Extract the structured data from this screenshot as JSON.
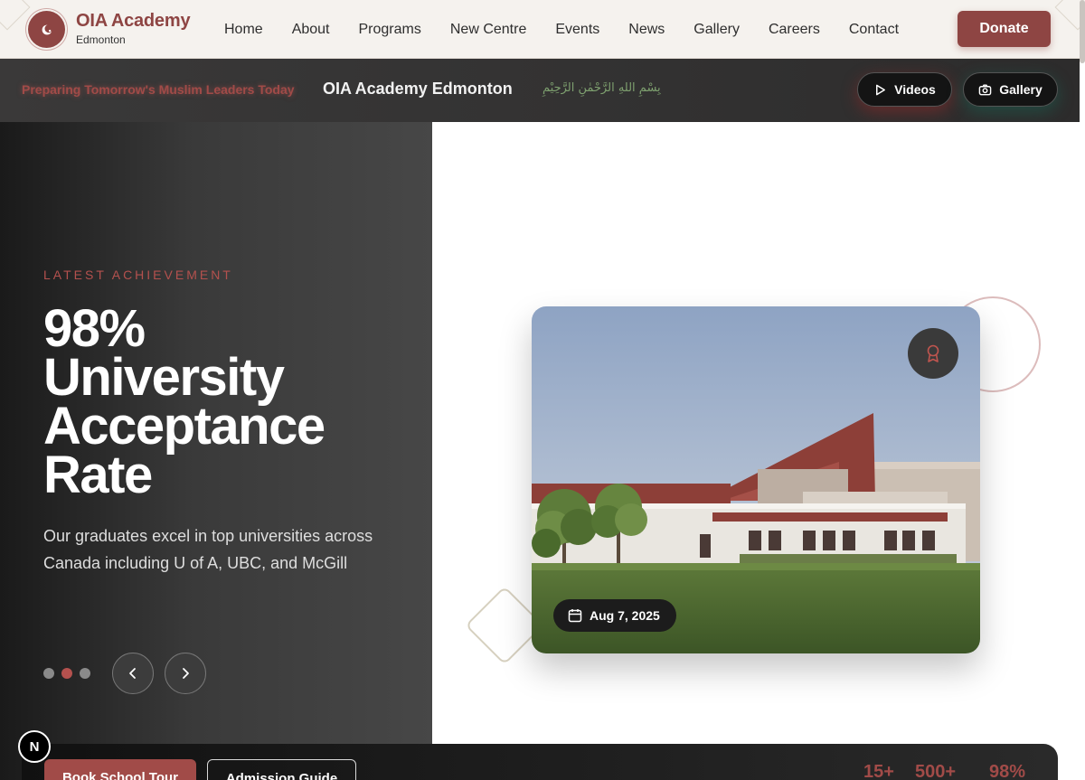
{
  "nav": {
    "brand_name": "OIA Academy",
    "brand_sub": "Edmonton",
    "items": [
      {
        "label": "Home"
      },
      {
        "label": "About"
      },
      {
        "label": "Programs"
      },
      {
        "label": "New Centre"
      },
      {
        "label": "Events"
      },
      {
        "label": "News"
      },
      {
        "label": "Gallery"
      },
      {
        "label": "Careers"
      },
      {
        "label": "Contact"
      }
    ],
    "donate_label": "Donate"
  },
  "banner": {
    "tagline": "Preparing Tomorrow's Muslim Leaders Today",
    "title": "OIA Academy Edmonton",
    "arabic": "بِسْمِ اللهِ الرَّحْمٰنِ الرَّحِيْمِ",
    "videos_label": "Videos",
    "gallery_label": "Gallery"
  },
  "hero": {
    "eyebrow": "LATEST ACHIEVEMENT",
    "headline_lines": [
      "98%",
      "University",
      "Acceptance",
      "Rate"
    ],
    "description": "Our graduates excel in top universities across Canada including U of A, UBC, and McGill",
    "active_slide": 2,
    "total_slides": 3,
    "date": "Aug 7, 2025"
  },
  "bottom": {
    "tour_label": "Book School Tour",
    "guide_label": "Admission Guide",
    "stats": [
      "15+",
      "500+",
      "98%"
    ]
  },
  "dev_badge": "N",
  "colors": {
    "brand": "#8e4543",
    "accent": "#b4514e",
    "dark": "#2d2c2c"
  }
}
